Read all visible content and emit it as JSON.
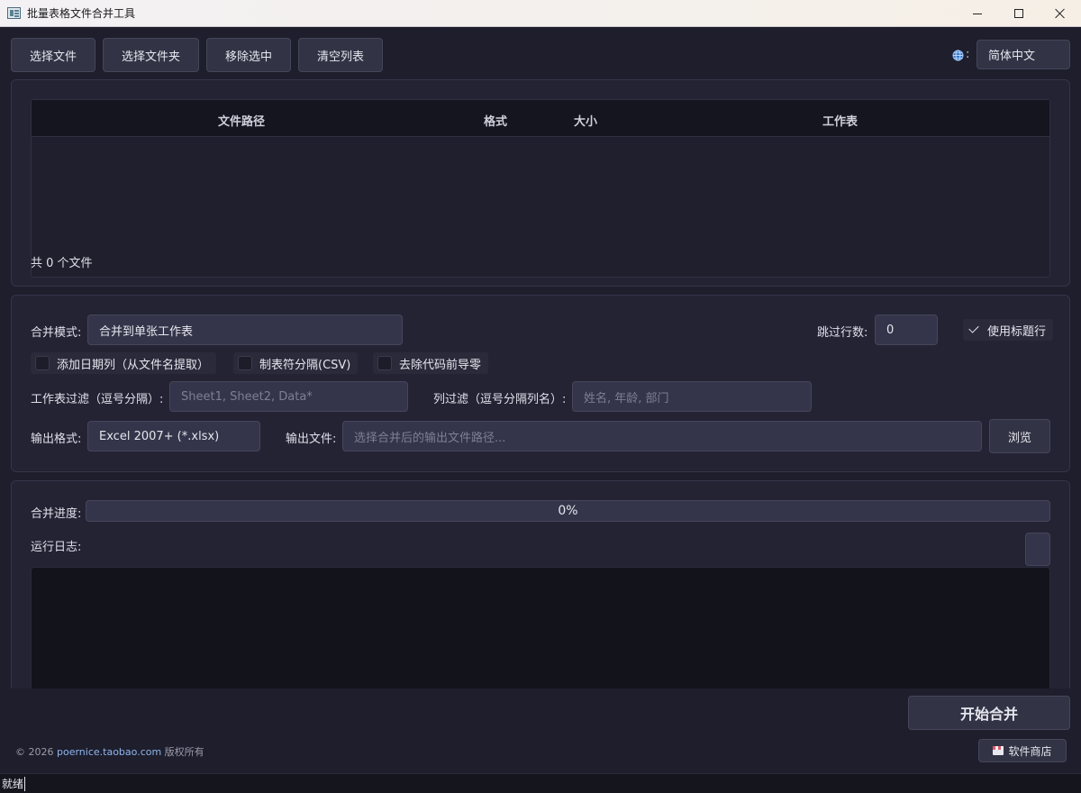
{
  "window": {
    "title": "批量表格文件合并工具"
  },
  "toolbar": {
    "select_files": "选择文件",
    "select_folder": "选择文件夹",
    "remove_selected": "移除选中",
    "clear_list": "清空列表",
    "language_colon": ":",
    "language_value": "简体中文",
    "language_icon": "globe-icon"
  },
  "file_table": {
    "columns": [
      "文件路径",
      "格式",
      "大小",
      "工作表"
    ],
    "rows": [],
    "count_text": "共 0 个文件"
  },
  "settings": {
    "merge_mode_label": "合并模式:",
    "merge_mode_value": "合并到单张工作表",
    "skip_rows_label": "跳过行数:",
    "skip_rows_value": "0",
    "use_header_label": "使用标题行",
    "use_header_checked": true,
    "add_date_label": "添加日期列（从文件名提取）",
    "add_date_checked": false,
    "tab_sep_label": "制表符分隔(CSV)",
    "tab_sep_checked": false,
    "strip_zeros_label": "去除代码前导零",
    "strip_zeros_checked": false,
    "sheet_filter_label": "工作表过滤（逗号分隔）:",
    "sheet_filter_placeholder": "Sheet1, Sheet2, Data*",
    "column_filter_label": "列过滤（逗号分隔列名）:",
    "column_filter_placeholder": "姓名, 年龄, 部门",
    "output_format_label": "输出格式:",
    "output_format_value": "Excel 2007+ (*.xlsx)",
    "output_file_label": "输出文件:",
    "output_file_placeholder": "选择合并后的输出文件路径...",
    "browse_label": "浏览"
  },
  "progress": {
    "label": "合并进度:",
    "value": 0,
    "text": "0%",
    "log_label": "运行日志:"
  },
  "footer": {
    "start_label": "开始合并",
    "copyright_prefix": "© 2026 ",
    "copyright_link": "poernice.taobao.com",
    "copyright_suffix": " 版权所有",
    "store_label": "软件商店"
  },
  "status": {
    "text": "就绪"
  }
}
